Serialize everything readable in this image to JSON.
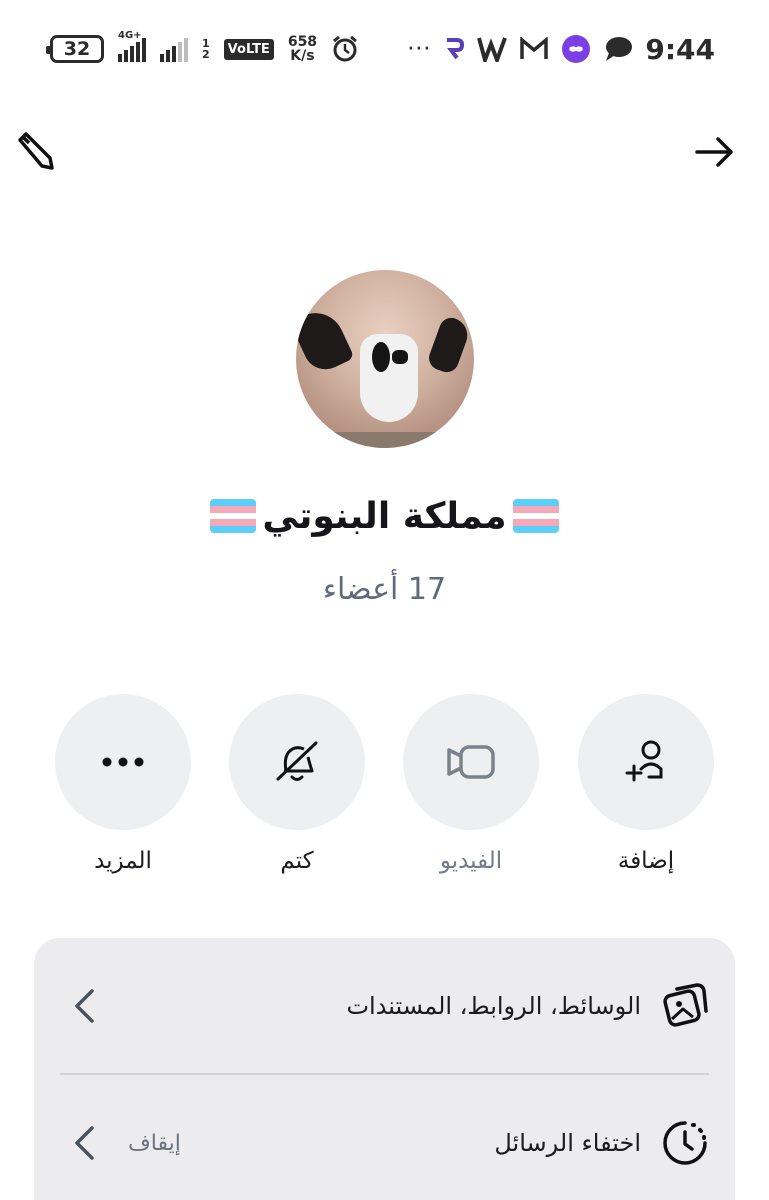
{
  "status_bar": {
    "battery": "32",
    "network_type": "4G+",
    "sim_slots": [
      "1",
      "2"
    ],
    "volte": "VoLTE",
    "speed_value": "658",
    "speed_unit": "K/s",
    "overflow": "···",
    "time": "9:44",
    "icons": [
      "alarm-icon",
      "ps-app-icon",
      "w-app-icon",
      "gmail-icon",
      "link-app-icon",
      "chat-bubbles-icon"
    ]
  },
  "header": {
    "left_icon": "pencil-icon",
    "right_icon": "arrow-right-icon"
  },
  "group": {
    "name": "مملكة البنوتي",
    "members": "17 أعضاء",
    "flag_colors": [
      "#5BCEFA",
      "#F5A9B8",
      "#FFFFFF",
      "#F5A9B8",
      "#5BCEFA"
    ]
  },
  "actions": [
    {
      "label": "إضافة",
      "icon": "add-person-icon"
    },
    {
      "label": "الفيديو",
      "icon": "video-camera-icon"
    },
    {
      "label": "كتم",
      "icon": "bell-muted-icon"
    },
    {
      "label": "المزيد",
      "icon": "more-dots-icon"
    }
  ],
  "menu": [
    {
      "label": "الوسائط، الروابط، المستندات",
      "icon": "media-gallery-icon"
    },
    {
      "label": "اختفاء الرسائل",
      "value": "إيقاف",
      "icon": "timer-clock-icon"
    }
  ],
  "colors": {
    "background": "#ffffff",
    "button_bg": "#eeeff1",
    "card_bg": "#ececee",
    "muted_text": "#5f6b7a"
  }
}
